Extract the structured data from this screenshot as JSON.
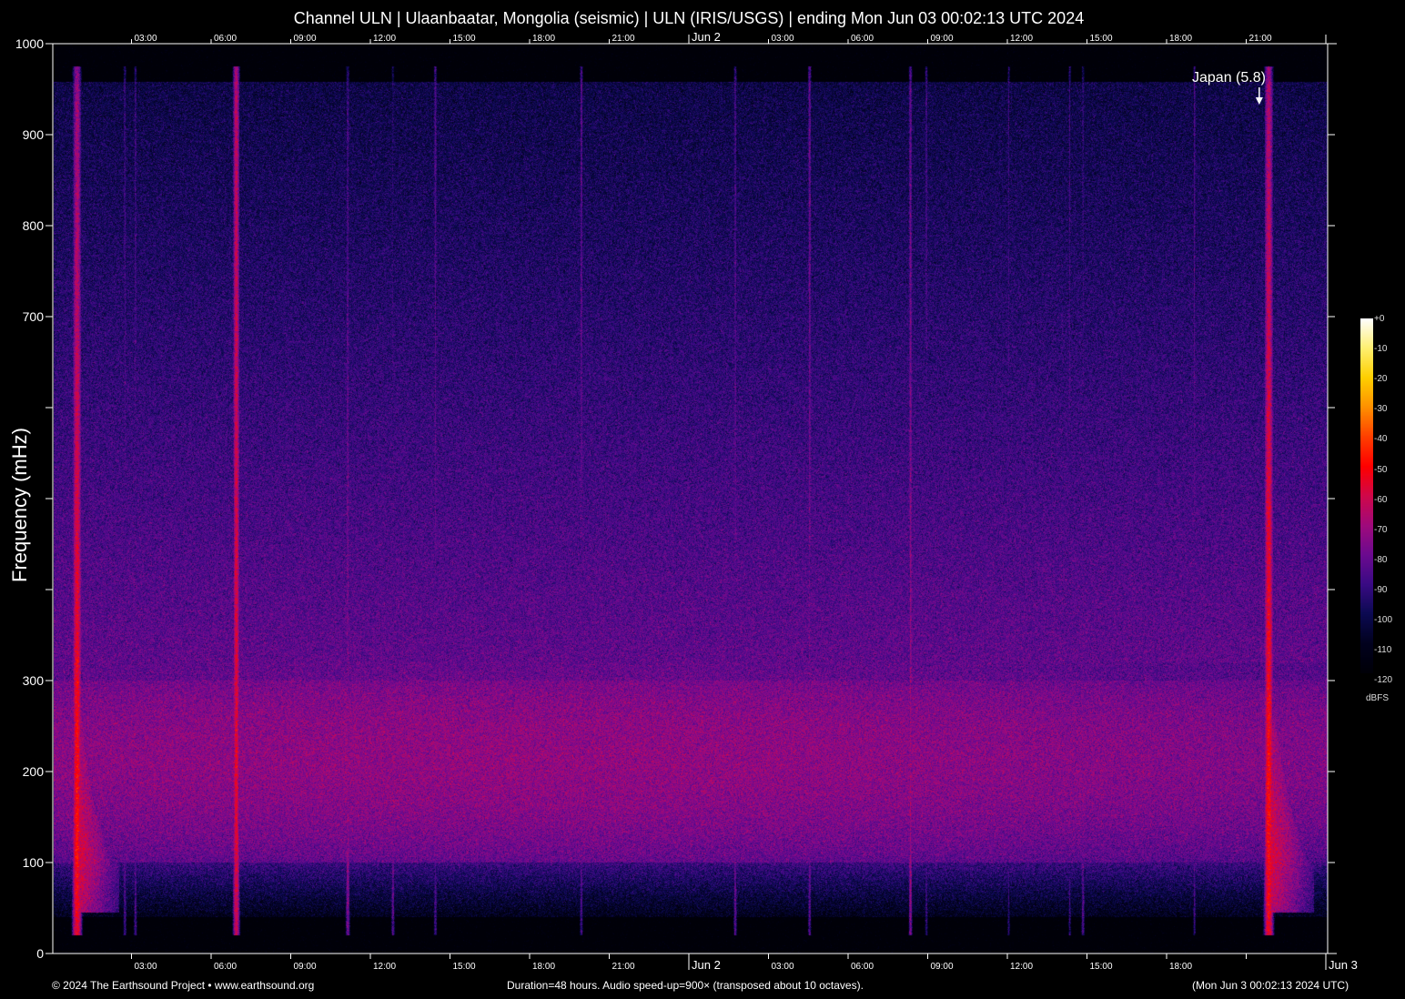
{
  "chart_data": {
    "type": "heatmap",
    "title": "Channel ULN | Ulaanbaatar, Mongolia (seismic) | ULN (IRIS/USGS) | ending Mon Jun 03 00:02:13 UTC 2024",
    "ylabel": "Frequency (mHz)",
    "xlabel": "",
    "ylim": [
      0,
      1000
    ],
    "xlim_hours": [
      0,
      48
    ],
    "y_ticks": [
      0,
      100,
      200,
      300,
      400,
      500,
      600,
      700,
      800,
      900,
      1000
    ],
    "y_tick_labels": [
      "0",
      "100",
      "200",
      "300",
      "",
      "",
      "",
      "700",
      "800",
      "900",
      "1000"
    ],
    "x_ticks_hours": [
      3,
      6,
      9,
      12,
      15,
      18,
      21,
      24,
      27,
      30,
      33,
      36,
      39,
      42,
      45,
      48
    ],
    "x_top_labels": [
      "03:00",
      "06:00",
      "09:00",
      "12:00",
      "15:00",
      "18:00",
      "21:00",
      "Jun  2",
      "03:00",
      "06:00",
      "09:00",
      "12:00",
      "15:00",
      "18:00",
      "21:00",
      ""
    ],
    "x_bottom_labels": [
      "03:00",
      "06:00",
      "09:00",
      "12:00",
      "15:00",
      "18:00",
      "21:00",
      "Jun  2",
      "03:00",
      "06:00",
      "09:00",
      "12:00",
      "15:00",
      "18:00",
      "",
      "Jun  3"
    ],
    "colorbar": {
      "label": "dBFS",
      "range": [
        -120,
        0
      ],
      "tick_labels": [
        "+0",
        "-10",
        "-20",
        "-30",
        "-40",
        "-50",
        "-60",
        "-70",
        "-80",
        "-90",
        "-100",
        "-110",
        "-120"
      ],
      "colors": [
        "#ffffff",
        "#fff070",
        "#ffd000",
        "#ff9000",
        "#ff4000",
        "#ff0000",
        "#d0084a",
        "#a00a7c",
        "#6c0a90",
        "#3a0a84",
        "#0c0a52",
        "#02021f",
        "#000008"
      ]
    },
    "events": [
      {
        "t": 0.9,
        "level": -45,
        "top_level": -70,
        "width": 0.12,
        "coda": 1.6
      },
      {
        "t": 6.9,
        "level": -55,
        "top_level": -62,
        "width": 0.09,
        "coda": 0.1
      },
      {
        "t": 2.7,
        "level": -85,
        "top_level": -92,
        "width": 0.05,
        "coda": 0
      },
      {
        "t": 3.1,
        "level": -85,
        "top_level": -92,
        "width": 0.05,
        "coda": 0
      },
      {
        "t": 11.1,
        "level": -72,
        "top_level": -92,
        "width": 0.06,
        "coda": 0
      },
      {
        "t": 12.8,
        "level": -80,
        "top_level": -98,
        "width": 0.05,
        "coda": 0
      },
      {
        "t": 14.4,
        "level": -86,
        "top_level": -86,
        "width": 0.05,
        "coda": 0
      },
      {
        "t": 19.9,
        "level": -86,
        "top_level": -84,
        "width": 0.05,
        "coda": 0
      },
      {
        "t": 25.7,
        "level": -80,
        "top_level": -90,
        "width": 0.05,
        "coda": 0
      },
      {
        "t": 28.5,
        "level": -82,
        "top_level": -80,
        "width": 0.05,
        "coda": 0
      },
      {
        "t": 32.3,
        "level": -70,
        "top_level": -82,
        "width": 0.05,
        "coda": 0
      },
      {
        "t": 32.9,
        "level": -90,
        "top_level": -90,
        "width": 0.05,
        "coda": 0
      },
      {
        "t": 36.0,
        "level": -92,
        "top_level": -92,
        "width": 0.04,
        "coda": 0
      },
      {
        "t": 38.3,
        "level": -90,
        "top_level": -90,
        "width": 0.04,
        "coda": 0
      },
      {
        "t": 38.8,
        "level": -82,
        "top_level": -96,
        "width": 0.05,
        "coda": 0
      },
      {
        "t": 43.0,
        "level": -88,
        "top_level": -86,
        "width": 0.04,
        "coda": 0
      },
      {
        "t": 45.8,
        "level": -45,
        "top_level": -66,
        "width": 0.12,
        "coda": 1.7
      }
    ],
    "annotations": [
      {
        "text": "Japan (5.8)",
        "t": 45.8
      }
    ]
  },
  "footer": {
    "copyright": "© 2024 The Earthsound Project • www.earthsound.org",
    "duration": "Duration=48 hours. Audio speed-up=900× (transposed about 10 octaves).",
    "end_time": "(Mon Jun  3 00:02:13 2024 UTC)"
  }
}
